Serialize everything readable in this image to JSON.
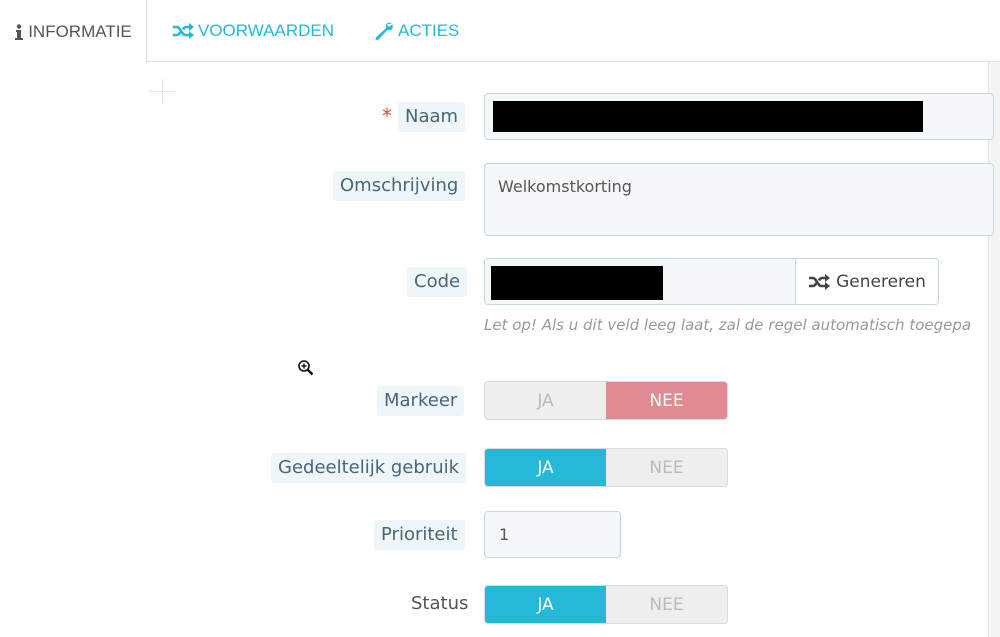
{
  "tabs": [
    {
      "label": "INFORMATIE",
      "icon": "info-icon",
      "active": true
    },
    {
      "label": "VOORWAARDEN",
      "icon": "shuffle-icon",
      "active": false
    },
    {
      "label": "ACTIES",
      "icon": "wrench-icon",
      "active": false
    }
  ],
  "colors": {
    "accent": "#25b9d7",
    "danger": "#e08b92",
    "required": "#ee4444"
  },
  "form": {
    "name": {
      "label": "Naam",
      "required_mark": "*",
      "value": ""
    },
    "description": {
      "label": "Omschrijving",
      "value": "Welkomstkorting"
    },
    "code": {
      "label": "Code",
      "value": "",
      "generate_label": "Genereren",
      "help": "Let op! Als u dit veld leeg laat, zal de regel automatisch toegepa"
    },
    "highlight": {
      "label": "Markeer",
      "yes": "JA",
      "no": "NEE",
      "selected": "NEE"
    },
    "partial_use": {
      "label": "Gedeeltelijk gebruik",
      "yes": "JA",
      "no": "NEE",
      "selected": "JA"
    },
    "priority": {
      "label": "Prioriteit",
      "value": "1"
    },
    "status": {
      "label": "Status",
      "yes": "JA",
      "no": "NEE",
      "selected": "JA"
    }
  }
}
